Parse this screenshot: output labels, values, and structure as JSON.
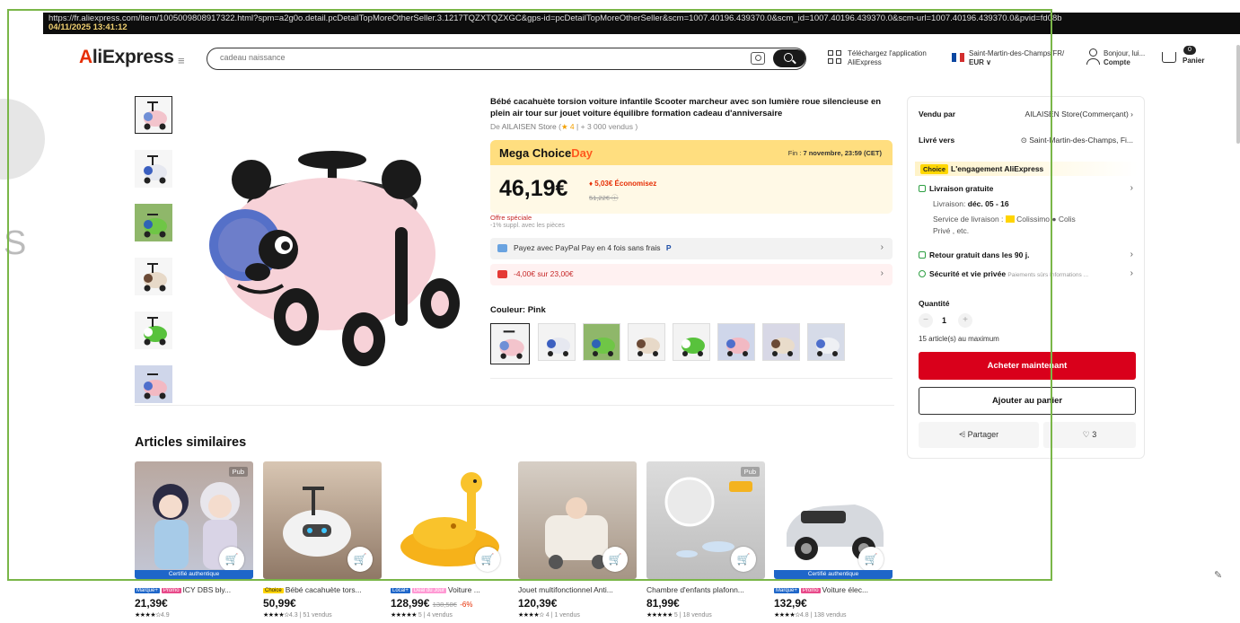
{
  "browser": {
    "url": "https://fr.aliexpress.com/item/1005009808917322.html?spm=a2g0o.detail.pcDetailTopMoreOtherSeller.3.1217TQZXTQZXGC&gps-id=pcDetailTopMoreOtherSeller&scm=1007.40196.439370.0&scm_id=1007.40196.439370.0&scm-url=1007.40196.439370.0&pvid=fd08b",
    "timestamp": "04/11/2025 13:41:12"
  },
  "header": {
    "logo": "AliExpress",
    "search_placeholder": "cadeau naissance",
    "app_line1": "Téléchargez l'application",
    "app_line2": "AliExpress",
    "location_line1": "Saint-Martin-des-Champs/FR/",
    "location_line2": "EUR ∨",
    "account_line1": "Bonjour, lui...",
    "account_line2": "Compte",
    "cart_count": "0",
    "cart_label": "Panier"
  },
  "product": {
    "title": "Bébé cacahuète torsion voiture infantile Scooter marcheur avec son lumière roue silencieuse en plein air tour sur jouet voiture équilibre formation cadeau d'anniversaire",
    "store_prefix": "De",
    "store_name": "AILAISEN Store",
    "store_rating": "★ 4",
    "store_sold": "| + 3 000 vendus )",
    "promo_title_1": "Mega Choice",
    "promo_title_2": "Day",
    "promo_end_label": "Fin :",
    "promo_end": "7 novembre, 23:59 (CET)",
    "price": "46,19€",
    "saving": "♦ 5,03€ Économisez",
    "old_price": "51,22€",
    "special_offer": "Offre spéciale",
    "special_offer_sub": "-1% suppl. avec les pièces",
    "paypal_text": "Payez avec PayPal Pay en 4 fois sans frais",
    "coupon_text": "-4,00€ sur 23,00€",
    "color_label": "Couleur: Pink",
    "colors": [
      "pink-blue",
      "white-blue",
      "green-blue",
      "brown",
      "green",
      "pink",
      "beige",
      "white-gray"
    ]
  },
  "sidebar": {
    "sold_by_label": "Vendu par",
    "sold_by_value": "AILAISEN Store(Commerçant) ›",
    "ship_to_label": "Livré vers",
    "ship_to_value": "⊙ Saint-Martin-des-Champs, Fi...",
    "choice_badge": "Choice",
    "choice_text": "L'engagement AliExpress",
    "free_delivery": "Livraison gratuite",
    "delivery_label": "Livraison:",
    "delivery_date": "déc. 05 - 16",
    "service_line1": "Service de livraison :",
    "service_line1_b": "Colissimo",
    "service_line1_c": "Colis",
    "service_line2": "Privé , etc.",
    "free_return": "Retour gratuit dans les 90 j.",
    "security": "Sécurité et vie privée",
    "security_sub": "Paiements sûrs Informations ...",
    "qty_label": "Quantité",
    "qty_value": "1",
    "qty_max": "15 article(s) au maximum",
    "buy_label": "Acheter maintenant",
    "cart_label": "Ajouter au panier",
    "share_label": "Partager",
    "fav_count": "3"
  },
  "similar": {
    "title": "Articles similaires",
    "items": [
      {
        "tags": [
          "Marque+",
          "Promo"
        ],
        "name": "ICY DBS bly...",
        "price": "21,39€",
        "old": "",
        "discount": "",
        "rating": "4.9",
        "sold": "",
        "pub": "Pub",
        "band": "Certifié authentique"
      },
      {
        "tags": [
          "Choice"
        ],
        "name": "Bébé cacahuète tors...",
        "price": "50,99€",
        "old": "",
        "discount": "",
        "rating": "4.3",
        "sold": "| 51 vendus",
        "pub": "",
        "band": ""
      },
      {
        "tags": [
          "Local+",
          "Deal du Jour"
        ],
        "name": "Voiture ...",
        "price": "128,99€",
        "old": "138,58€",
        "discount": "-6%",
        "rating": "5",
        "sold": "| 4 vendus",
        "pub": "",
        "band": ""
      },
      {
        "tags": [],
        "name": "Jouet multifonctionnel Anti...",
        "price": "120,39€",
        "old": "",
        "discount": "",
        "rating": "4",
        "sold": "| 1 vendus",
        "pub": "",
        "band": ""
      },
      {
        "tags": [],
        "name": "Chambre d'enfants plafonn...",
        "price": "81,99€",
        "old": "",
        "discount": "",
        "rating": "5",
        "sold": "| 18 vendus",
        "pub": "Pub",
        "band": ""
      },
      {
        "tags": [
          "Marque+",
          "Promo"
        ],
        "name": "Voiture élec...",
        "price": "132,9€",
        "old": "",
        "discount": "",
        "rating": "4.8",
        "sold": "| 138 vendus",
        "pub": "",
        "band": "Certifié authentique"
      }
    ]
  },
  "colors": {
    "accent": "#e62e04",
    "buy": "#d9001b",
    "frame": "#7ab648",
    "promo_band": "#ffde7f"
  }
}
